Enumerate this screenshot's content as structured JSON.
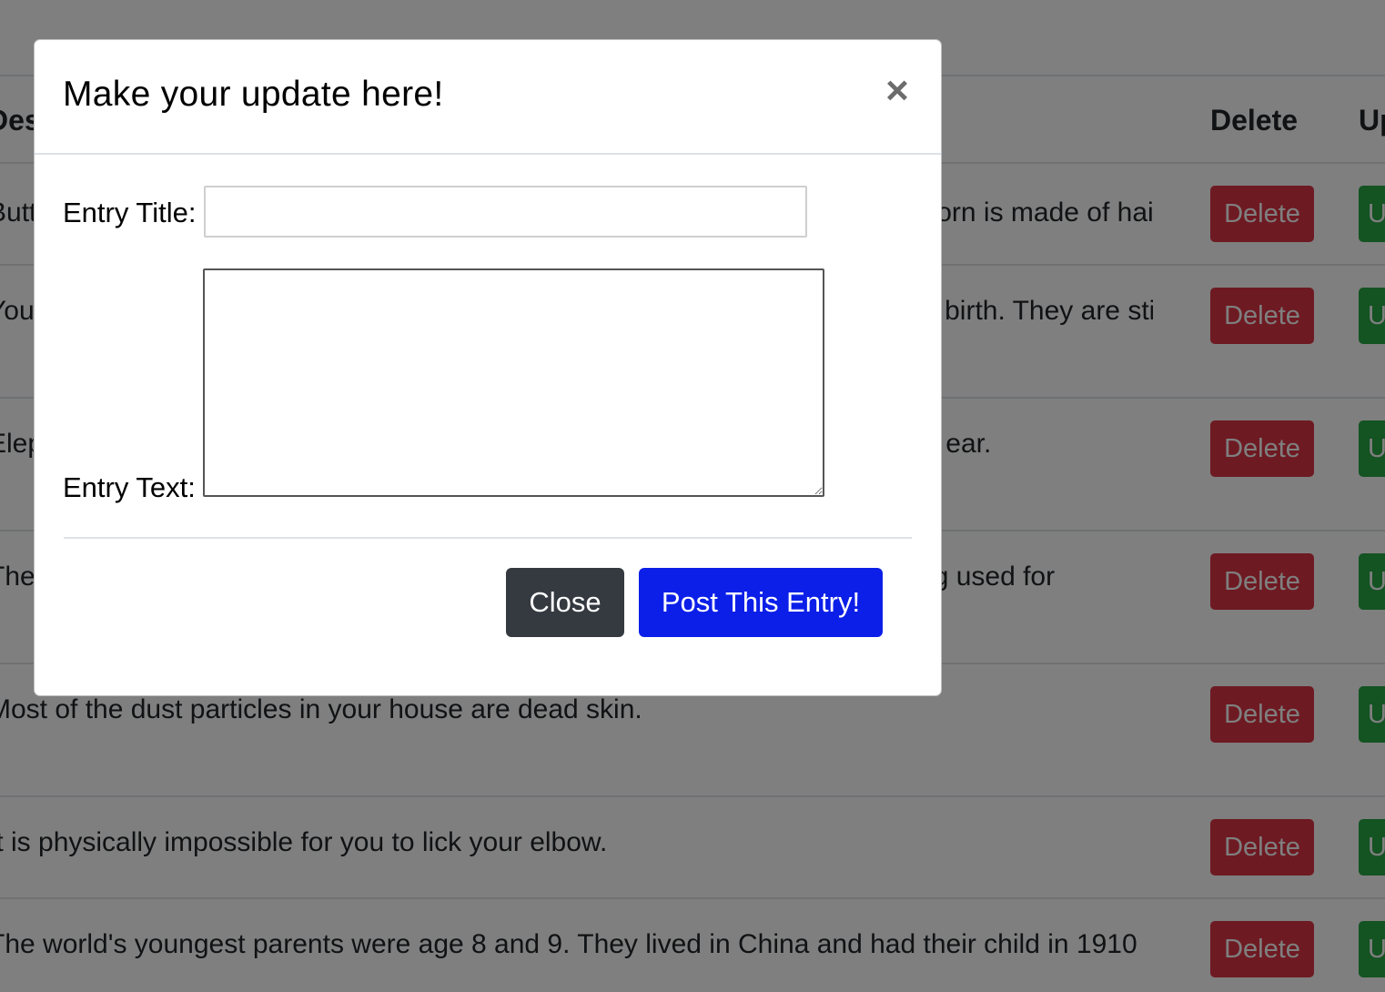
{
  "table": {
    "headers": {
      "description": "Description",
      "delete": "Delete",
      "update": "Update"
    },
    "rows": [
      {
        "description": "Butterflies taste with their feet. A snail can sleep for three years. A rhinoceros horn is made of hair.",
        "delete_label": "Delete",
        "update_label": "Update"
      },
      {
        "description": "Your nose and ears never stop growing, but your eyes stay the same size from birth. They are still growing.",
        "delete_label": "Delete",
        "update_label": "Update"
      },
      {
        "description": "Elephants are the only animals that cannot jump. A cat has 32 muscles in each ear.",
        "delete_label": "Delete",
        "update_label": "Update"
      },
      {
        "description": "The song 'Happy Birthday' was copyrighted until 2016, and it is a common song used for",
        "delete_label": "Delete",
        "update_label": "Update"
      },
      {
        "description": "Most of the dust particles in your house are dead skin.",
        "delete_label": "Delete",
        "update_label": "Update"
      },
      {
        "description": "It is physically impossible for you to lick your elbow.",
        "delete_label": "Delete",
        "update_label": "Update"
      },
      {
        "description": "The world's youngest parents were age 8 and 9. They lived in China and had their child in 1910",
        "delete_label": "Delete",
        "update_label": "Update"
      }
    ]
  },
  "modal": {
    "title": "Make your update here!",
    "close_symbol": "×",
    "entry_title_label": "Entry Title:",
    "entry_title_value": "",
    "entry_text_label": "Entry Text:",
    "entry_text_value": "",
    "close_button_label": "Close",
    "post_button_label": "Post This Entry!"
  },
  "colors": {
    "backdrop": "rgba(0,0,0,0.5)",
    "delete": "#dc3545",
    "update": "#28a745",
    "close_button": "#343a40",
    "post_button": "#0c1fe8"
  },
  "icons": {
    "close": "close-icon",
    "resize": "resize-grip-icon"
  }
}
